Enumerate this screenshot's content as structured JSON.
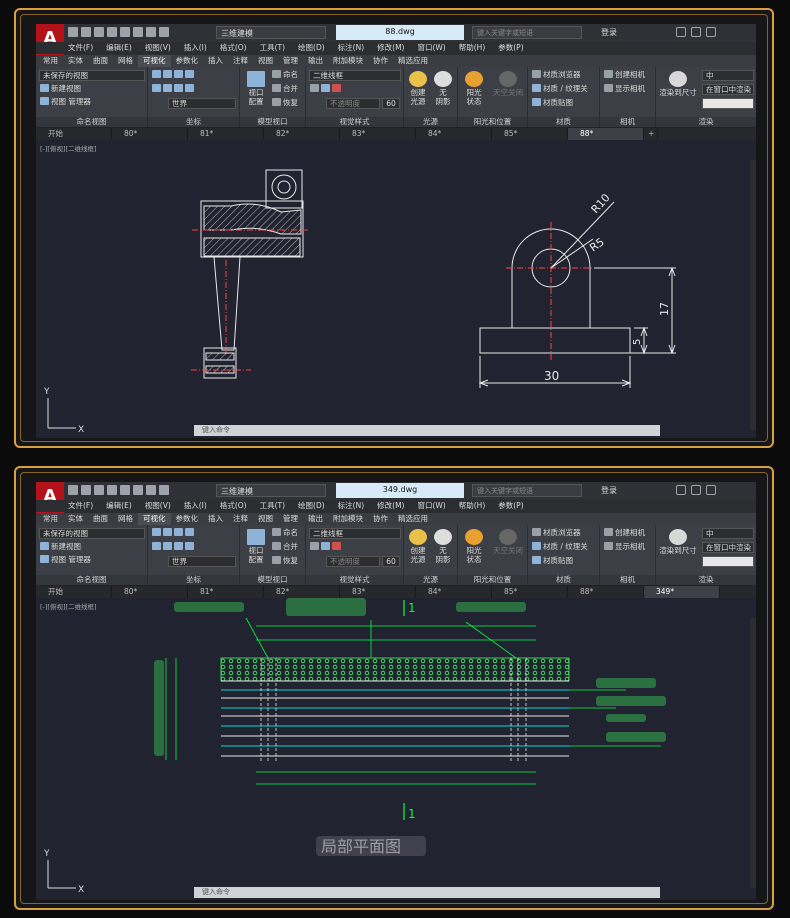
{
  "colors": {
    "frame_gold": "#d8a040",
    "canvas": "#212330",
    "autocad_red": "#b4121b",
    "dim_green": "#00ff40",
    "cyan": "#00d8d8"
  },
  "windows": [
    {
      "logo": "A",
      "workspace": "三维建模",
      "filename": "88.dwg",
      "search_placeholder": "键入关键字或短语",
      "login": "登录",
      "menu": [
        "文件(F)",
        "编辑(E)",
        "视图(V)",
        "插入(I)",
        "格式(O)",
        "工具(T)",
        "绘图(D)",
        "标注(N)",
        "修改(M)",
        "窗口(W)",
        "帮助(H)",
        "参数(P)"
      ],
      "tabs": [
        "常用",
        "实体",
        "曲面",
        "网格",
        "可视化",
        "参数化",
        "插入",
        "注释",
        "视图",
        "管理",
        "输出",
        "附加模块",
        "协作",
        "精选应用"
      ],
      "active_tab": "可视化",
      "ribbon": {
        "named_view": {
          "dropdown": "未保存的视图",
          "new": "新建视图",
          "manager": "视图 管理器",
          "title": "命名视图"
        },
        "coords": {
          "world": "世界",
          "title": "坐标"
        },
        "model_vp": {
          "config": "视口\n配置",
          "name": "命名",
          "merge": "合并",
          "restore": "恢复",
          "title": "模型视口"
        },
        "visual": {
          "dropdown": "二维线框",
          "transparency": "不透明度",
          "value": "60",
          "title": "视觉样式"
        },
        "light": {
          "create": "创建\n光源",
          "shadow": "无\n阴影",
          "title": "光源"
        },
        "sun": {
          "status": "阳光\n状态",
          "sky": "天空关闭",
          "title": "阳光和位置"
        },
        "material": {
          "browser": "材质浏览器",
          "texture": "材质 / 纹理关",
          "map": "材质贴图",
          "title": "材质"
        },
        "camera": {
          "create": "创建相机",
          "show": "显示相机",
          "title": "相机"
        },
        "render": {
          "quality": "中",
          "in_window": "在窗口中渲染",
          "to_size": "渲染到尺寸",
          "title": "渲染"
        }
      },
      "doc_tabs": [
        "开始",
        "80*",
        "81*",
        "82*",
        "83*",
        "84*",
        "85*",
        "88*"
      ],
      "active_doc": "88*",
      "viewport_label": "[-][俯视][二维线框]",
      "command_prompt": "键入命令",
      "dims": {
        "r10": "R10",
        "r5": "R5",
        "d17": "17",
        "d5": "5",
        "d30": "30"
      },
      "ucs": {
        "x": "X",
        "y": "Y"
      }
    },
    {
      "logo": "A",
      "workspace": "三维建模",
      "filename": "349.dwg",
      "search_placeholder": "键入关键字或短语",
      "login": "登录",
      "menu": [
        "文件(F)",
        "编辑(E)",
        "视图(V)",
        "插入(I)",
        "格式(O)",
        "工具(T)",
        "绘图(D)",
        "标注(N)",
        "修改(M)",
        "窗口(W)",
        "帮助(H)",
        "参数(P)"
      ],
      "tabs": [
        "常用",
        "实体",
        "曲面",
        "网格",
        "可视化",
        "参数化",
        "插入",
        "注释",
        "视图",
        "管理",
        "输出",
        "附加模块",
        "协作",
        "精选应用"
      ],
      "active_tab": "可视化",
      "ribbon": {
        "named_view": {
          "dropdown": "未保存的视图",
          "new": "新建视图",
          "manager": "视图 管理器",
          "title": "命名视图"
        },
        "coords": {
          "world": "世界",
          "title": "坐标"
        },
        "model_vp": {
          "config": "视口\n配置",
          "name": "命名",
          "merge": "合并",
          "restore": "恢复",
          "title": "模型视口"
        },
        "visual": {
          "dropdown": "二维线框",
          "transparency": "不透明度",
          "value": "60",
          "title": "视觉样式"
        },
        "light": {
          "create": "创建\n光源",
          "shadow": "无\n阴影",
          "title": "光源"
        },
        "sun": {
          "status": "阳光\n状态",
          "sky": "天空关闭",
          "title": "阳光和位置"
        },
        "material": {
          "browser": "材质浏览器",
          "texture": "材质 / 纹理关",
          "map": "材质贴图",
          "title": "材质"
        },
        "camera": {
          "create": "创建相机",
          "show": "显示相机",
          "title": "相机"
        },
        "render": {
          "quality": "中",
          "in_window": "在窗口中渲染",
          "to_size": "渲染到尺寸",
          "title": "渲染"
        }
      },
      "doc_tabs": [
        "开始",
        "80*",
        "81*",
        "82*",
        "83*",
        "84*",
        "85*",
        "88*",
        "349*"
      ],
      "active_doc": "349*",
      "viewport_label": "[-][俯视][二维线框]",
      "command_prompt": "键入命令",
      "section_mark": "1",
      "caption": "局部平面图",
      "ucs": {
        "x": "X",
        "y": "Y"
      }
    }
  ]
}
